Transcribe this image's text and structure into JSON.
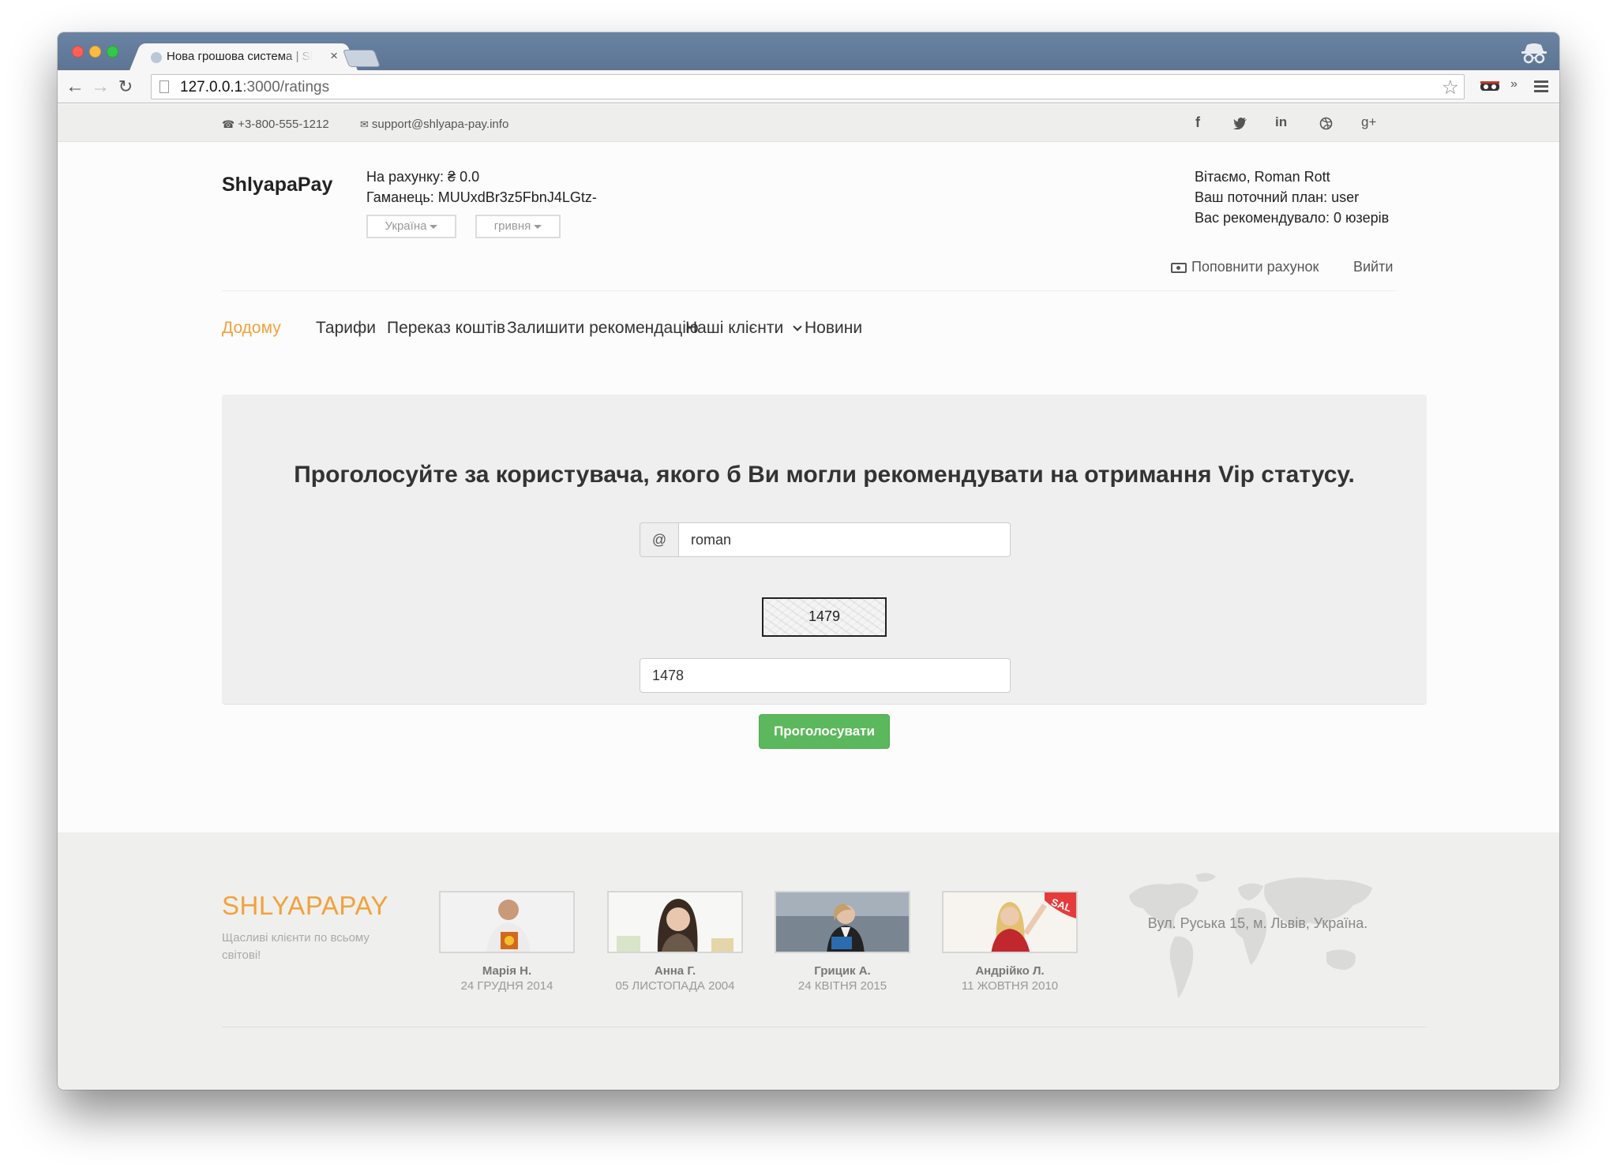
{
  "browser": {
    "tab_title": "Нова грошова система | Shlyapa",
    "tab_close": "×",
    "url_host": "127.0.0.1",
    "url_path": ":3000/ratings"
  },
  "topbar": {
    "phone": "+3-800-555-1212",
    "email": "support@shlyapa-pay.info",
    "social": [
      "f",
      "t",
      "in",
      "dribbble",
      "g+"
    ]
  },
  "header": {
    "brand": "ShlyapaPay",
    "balance": "На рахунку: ₴ 0.0",
    "wallet": "Гаманець: MUUxdBr3z5FbnJ4LGtz-",
    "country_select": "Україна",
    "currency_select": "гривня",
    "greeting": "Вітаємо, Roman Rott",
    "plan": "Ваш поточний план: user",
    "referrals": "Вас рекомендувало: 0 юзерів",
    "topup": "Поповнити рахунок",
    "logout": "Вийти"
  },
  "nav": {
    "items": [
      {
        "label": "Додому",
        "active": true
      },
      {
        "label": "Тарифи"
      },
      {
        "label": "Переказ коштів"
      },
      {
        "label": "Залишити рекомендацію"
      },
      {
        "label": "Наші клієнти"
      },
      {
        "label": "Новини"
      }
    ],
    "active_color": "#f0a23c"
  },
  "vote": {
    "title": "Проголосуйте за користувача, якого б Ви могли рекомендувати на отримання Vip статусу.",
    "username_addon": "@",
    "username_value": "roman",
    "captcha_code": "1479",
    "captcha_value": "1478",
    "submit_label": "Проголосувати",
    "submit_color": "#5cb85c"
  },
  "footer": {
    "brand": "SHLYAPAPAY",
    "tagline": "Щасливі клієнти по всьому світові!",
    "clients": [
      {
        "name": "Марія Н.",
        "date": "24 ГРУДНЯ 2014"
      },
      {
        "name": "Анна Г.",
        "date": "05 ЛИСТОПАДА 2004"
      },
      {
        "name": "Грицик А.",
        "date": "24 КВІТНЯ 2015"
      },
      {
        "name": "Андрійко Л.",
        "date": "11 ЖОВТНЯ 2010"
      }
    ],
    "address": "Вул. Руська 15, м. Львів, Україна."
  }
}
